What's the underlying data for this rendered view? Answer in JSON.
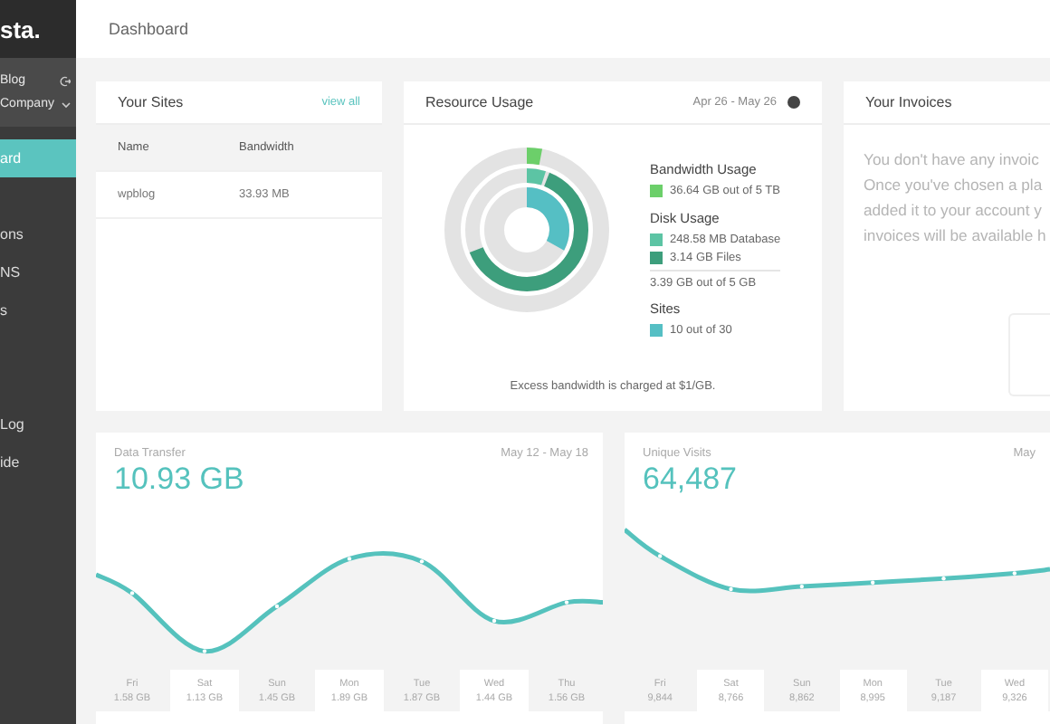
{
  "sidebar": {
    "logo": "sta.",
    "account": {
      "site": "Blog",
      "company": "Company"
    },
    "sections": [
      [
        {
          "label": "ard",
          "selected": true
        }
      ],
      [
        {
          "label": "ons",
          "selected": false
        },
        {
          "label": "NS",
          "selected": false
        },
        {
          "label": "s",
          "selected": false
        }
      ],
      [
        {
          "label": "Log",
          "selected": false
        },
        {
          "label": "ide",
          "selected": false
        }
      ]
    ]
  },
  "header": {
    "title": "Dashboard"
  },
  "sites": {
    "title": "Your Sites",
    "link": "view all",
    "columns": [
      "Name",
      "Bandwidth"
    ],
    "rows": [
      [
        "wpblog",
        "33.93 MB"
      ]
    ]
  },
  "resources": {
    "title": "Resource Usage",
    "period": "Apr 26 - May 26",
    "groups": [
      {
        "title": "Bandwidth Usage",
        "items": [
          {
            "label": "36.64 GB out of 5 TB",
            "color": "#6ccf6a"
          }
        ]
      },
      {
        "title": "Disk Usage",
        "items": [
          {
            "label": "248.58 MB Database",
            "color": "#5cc4a4"
          },
          {
            "label": "3.14 GB Files",
            "color": "#3d9e7c"
          }
        ],
        "total": "3.39 GB out of 5 GB"
      },
      {
        "title": "Sites",
        "items": [
          {
            "label": "10 out of 30",
            "color": "#55bfc4"
          }
        ]
      }
    ],
    "note": "Excess bandwidth is charged at $1/GB."
  },
  "invoices": {
    "title": "Your Invoices",
    "lines": [
      "You don't have any invoic",
      "Once you've chosen a pla",
      "added it to your account y",
      "invoices will be available h"
    ]
  },
  "stats": [
    {
      "title": "Data Transfer",
      "value": "10.93 GB",
      "period": "May 12 - May 18",
      "days": [
        {
          "day": "Fri",
          "value": "1.58 GB"
        },
        {
          "day": "Sat",
          "value": "1.13 GB"
        },
        {
          "day": "Sun",
          "value": "1.45 GB"
        },
        {
          "day": "Mon",
          "value": "1.89 GB"
        },
        {
          "day": "Tue",
          "value": "1.87 GB"
        },
        {
          "day": "Wed",
          "value": "1.44 GB"
        },
        {
          "day": "Thu",
          "value": "1.56 GB"
        }
      ]
    },
    {
      "title": "Unique Visits",
      "value": "64,487",
      "period": "May",
      "days": [
        {
          "day": "Fri",
          "value": "9,844"
        },
        {
          "day": "Sat",
          "value": "8,766"
        },
        {
          "day": "Sun",
          "value": "8,862"
        },
        {
          "day": "Mon",
          "value": "8,995"
        },
        {
          "day": "Tue",
          "value": "9,187"
        },
        {
          "day": "Wed",
          "value": "9,326"
        }
      ]
    }
  ]
}
